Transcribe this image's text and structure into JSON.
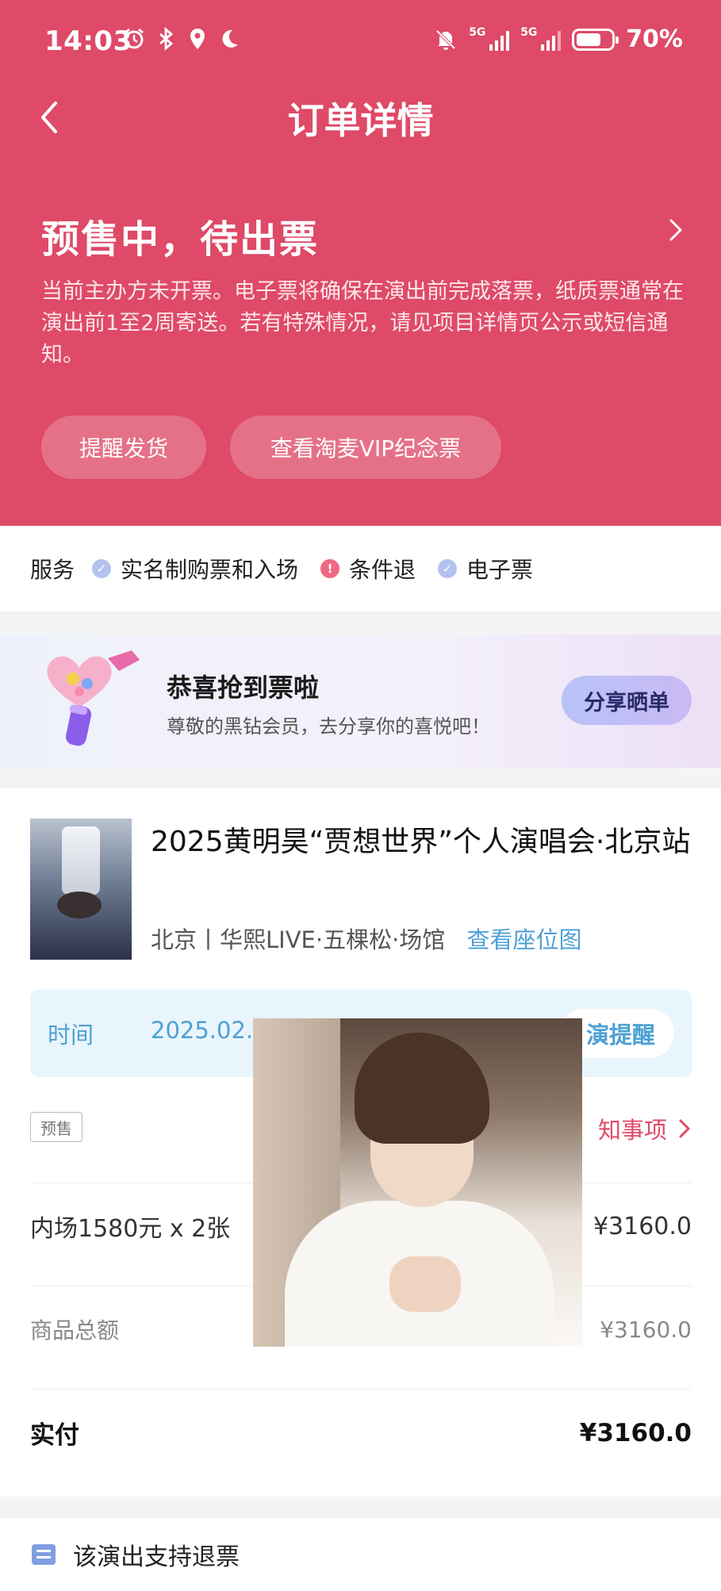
{
  "status_bar": {
    "time": "14:03",
    "network_1": "5G",
    "network_2": "5G",
    "battery": "70%",
    "battery_level": 0.7,
    "icons": [
      "alarm-icon",
      "bluetooth-icon",
      "location-icon",
      "moon-icon",
      "mute-icon",
      "signal-icon",
      "battery-icon"
    ]
  },
  "nav": {
    "title": "订单详情",
    "back_icon": "chevron-left-icon"
  },
  "status": {
    "title": "预售中，待出票",
    "description": "当前主办方未开票。电子票将确保在演出前完成落票，纸质票通常在演出前1至2周寄送。若有特殊情况，请见项目详情页公示或短信通知。",
    "buttons": [
      "提醒发货",
      "查看淘麦VIP纪念票"
    ]
  },
  "services": {
    "label": "服务",
    "items": [
      {
        "label": "实名制购票和入场",
        "kind": "check"
      },
      {
        "label": "条件退",
        "kind": "alert"
      },
      {
        "label": "电子票",
        "kind": "check"
      }
    ]
  },
  "promo": {
    "title": "恭喜抢到票啦",
    "subtitle": "尊敬的黑钻会员，去分享你的喜悦吧！",
    "button": "分享晒单"
  },
  "event": {
    "title": "2025黄明昊“贾想世界”个人演唱会·北京站",
    "venue": "北京丨华熙LIVE·五棵松·场馆",
    "seat_map": "查看座位图"
  },
  "time_row": {
    "label": "时间",
    "date_partial": "2025.02.",
    "reminder_partial": "演提醒"
  },
  "tag": "预售",
  "notice_partial": "知事项",
  "price_rows": [
    {
      "label": "内场1580元 x 2张",
      "value": "¥3160.0"
    },
    {
      "label": "商品总额",
      "value": "¥3160.0"
    },
    {
      "label": "实付",
      "value": "¥3160.0"
    }
  ],
  "refund": {
    "label": "该演出支持退票"
  },
  "colors": {
    "brand": "#de4a67",
    "link": "#4ea0d4"
  }
}
